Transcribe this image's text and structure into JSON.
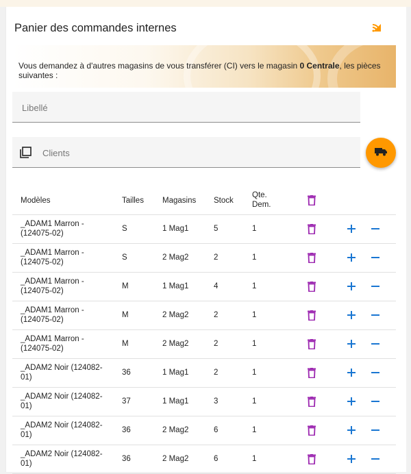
{
  "header": {
    "title": "Panier des commandes internes",
    "rss_icon": "rss-icon"
  },
  "banner": {
    "text_before": "Vous demandez à d'autres magasins de vous transférer (CI) vers le magasin ",
    "store": "0 Centrale",
    "text_after": ", les pièces suivantes :"
  },
  "fields": {
    "libelle_placeholder": "Libellé",
    "clients_placeholder": "Clients"
  },
  "fab": {
    "icon": "truck-icon",
    "color": "#ff9800"
  },
  "colors": {
    "accent": "#ff9800",
    "delete": "#9c27b0",
    "action": "#1976d2"
  },
  "table": {
    "headers": {
      "model": "Modèles",
      "size": "Tailles",
      "store": "Magasins",
      "stock": "Stock",
      "qty": "Qte. Dem."
    },
    "rows": [
      {
        "model": "_ADAM1 Marron - (124075-02)",
        "size": "S",
        "store": "1 Mag1",
        "stock": "5",
        "qty": "1"
      },
      {
        "model": "_ADAM1 Marron - (124075-02)",
        "size": "S",
        "store": "2 Mag2",
        "stock": "2",
        "qty": "1"
      },
      {
        "model": "_ADAM1 Marron - (124075-02)",
        "size": "M",
        "store": "1 Mag1",
        "stock": "4",
        "qty": "1"
      },
      {
        "model": "_ADAM1 Marron - (124075-02)",
        "size": "M",
        "store": "2 Mag2",
        "stock": "2",
        "qty": "1"
      },
      {
        "model": "_ADAM1 Marron - (124075-02)",
        "size": "M",
        "store": "2 Mag2",
        "stock": "2",
        "qty": "1"
      },
      {
        "model": "_ADAM2 Noir (124082-01)",
        "size": "36",
        "store": "1 Mag1",
        "stock": "2",
        "qty": "1"
      },
      {
        "model": "_ADAM2 Noir (124082-01)",
        "size": "37",
        "store": "1 Mag1",
        "stock": "3",
        "qty": "1"
      },
      {
        "model": "_ADAM2 Noir (124082-01)",
        "size": "36",
        "store": "2 Mag2",
        "stock": "6",
        "qty": "1"
      },
      {
        "model": "_ADAM2 Noir (124082-01)",
        "size": "36",
        "store": "2 Mag2",
        "stock": "6",
        "qty": "1"
      }
    ]
  }
}
